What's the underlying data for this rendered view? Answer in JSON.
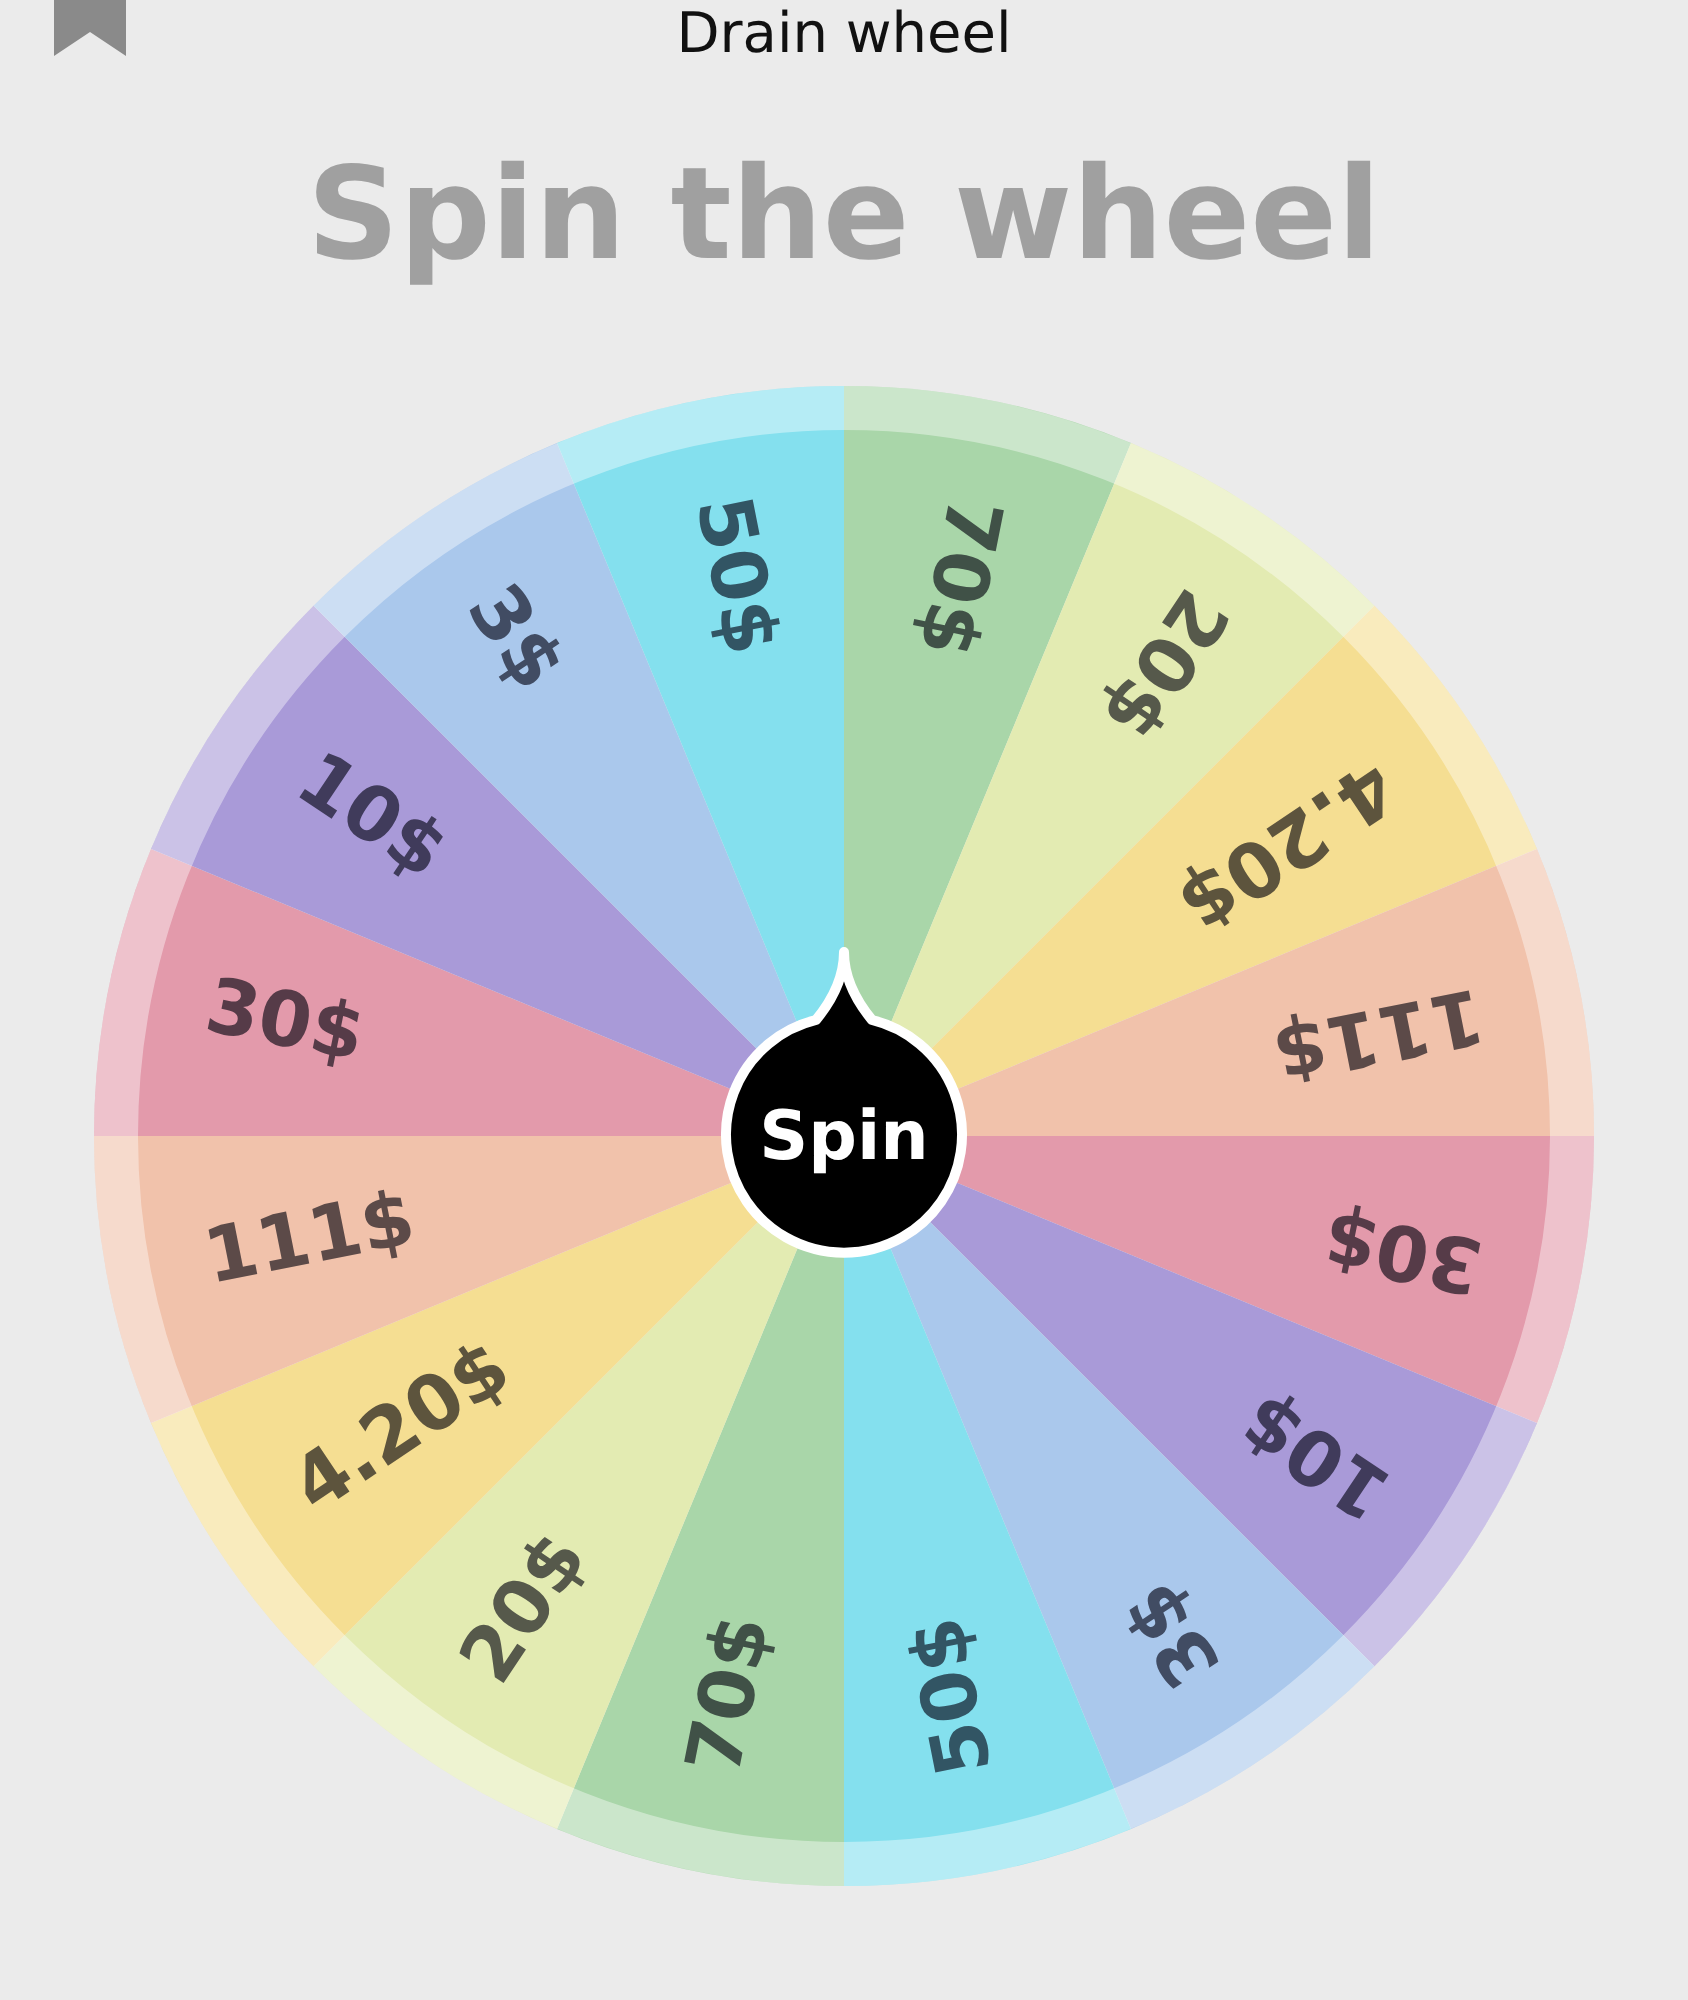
{
  "header": {
    "title": "Drain wheel"
  },
  "heading": "Spin the wheel",
  "wheel": {
    "segments": [
      {
        "label": "70$",
        "color": "#a9d6a9"
      },
      {
        "label": "20$",
        "color": "#e3ebb2"
      },
      {
        "label": "4.20$",
        "color": "#f5de92"
      },
      {
        "label": "111$",
        "color": "#f1c2ab"
      },
      {
        "label": "30$",
        "color": "#e39aab"
      },
      {
        "label": "10$",
        "color": "#a99ad8"
      },
      {
        "label": "3$",
        "color": "#aac8ec"
      },
      {
        "label": "50$",
        "color": "#84e0ee"
      },
      {
        "label": "70$",
        "color": "#a9d6a9"
      },
      {
        "label": "20$",
        "color": "#e3ebb2"
      },
      {
        "label": "4.20$",
        "color": "#f5de92"
      },
      {
        "label": "111$",
        "color": "#f1c2ab"
      },
      {
        "label": "30$",
        "color": "#e39aab"
      },
      {
        "label": "10$",
        "color": "#a99ad8"
      },
      {
        "label": "3$",
        "color": "#aac8ec"
      },
      {
        "label": "50$",
        "color": "#84e0ee"
      }
    ],
    "spin_button": "Spin"
  }
}
